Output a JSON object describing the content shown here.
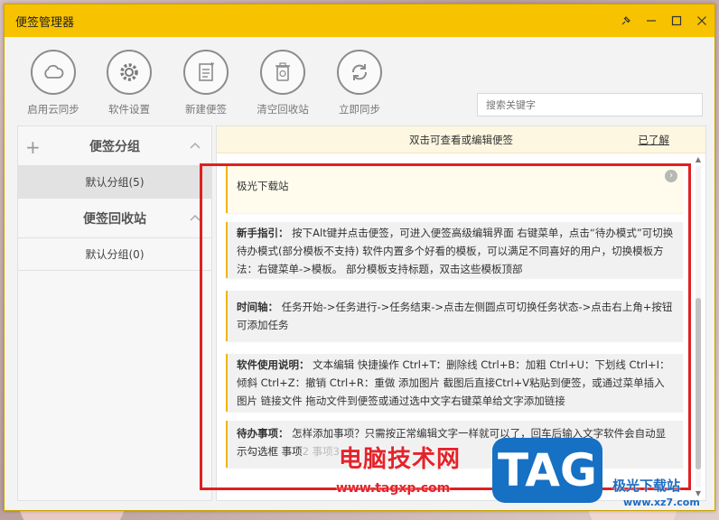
{
  "window": {
    "title": "便签管理器"
  },
  "toolbar": {
    "items": [
      {
        "label": "启用云同步",
        "icon": "cloud-icon"
      },
      {
        "label": "软件设置",
        "icon": "gear-icon"
      },
      {
        "label": "新建便签",
        "icon": "new-note-icon"
      },
      {
        "label": "清空回收站",
        "icon": "recycle-bin-icon"
      },
      {
        "label": "立即同步",
        "icon": "sync-icon"
      }
    ],
    "search_placeholder": "搜索关键字"
  },
  "sidebar": {
    "groups_title": "便签分组",
    "groups_items": [
      "默认分组(5)"
    ],
    "recycle_title": "便签回收站",
    "recycle_items": [
      "默认分组(0)"
    ]
  },
  "notes_panel": {
    "hint": "双击可查看或编辑便签",
    "ack": "已了解",
    "notes": [
      {
        "text": "极光下载站"
      },
      {
        "title": "新手指引：",
        "text": "按下Alt键并点击便签，可进入便签高级编辑界面  右键菜单，点击“待办模式”可切换待办模式(部分模板不支持)  软件内置多个好看的模板，可以满足不同喜好的用户，切换模板方法：右键菜单->模板。  部分模板支持标题，双击这些模板顶部"
      },
      {
        "title": "时间轴：",
        "text": "任务开始->任务进行->任务结束->点击左侧圆点可切换任务状态->点击右上角+按钮可添加任务"
      },
      {
        "title": "软件使用说明：",
        "text": "文本编辑  快捷操作 Ctrl+T：删除线 Ctrl+B：加粗 Ctrl+U：下划线 Ctrl+I：倾斜 Ctrl+Z：撤销 Ctrl+R：重做  添加图片 截图后直接Ctrl+V粘贴到便签，或通过菜单插入图片  链接文件 拖动文件到便签或通过选中文字右键菜单给文字添加链接"
      },
      {
        "title": "待办事项：",
        "text": "怎样添加事项？只需按正常编辑文字一样就可以了，回车后输入文字软件会自动显示勾选框  事项",
        "overflow": "2 事项3"
      }
    ]
  },
  "watermark": {
    "text": "电脑技术网",
    "url": "www.tagxp.com",
    "logo": "TAG",
    "site": "极光下载站",
    "site_url": "www.xz7.com"
  },
  "colors": {
    "titlebar": "#f7c200",
    "accent": "#f0b600",
    "highlight": "#e02020"
  }
}
